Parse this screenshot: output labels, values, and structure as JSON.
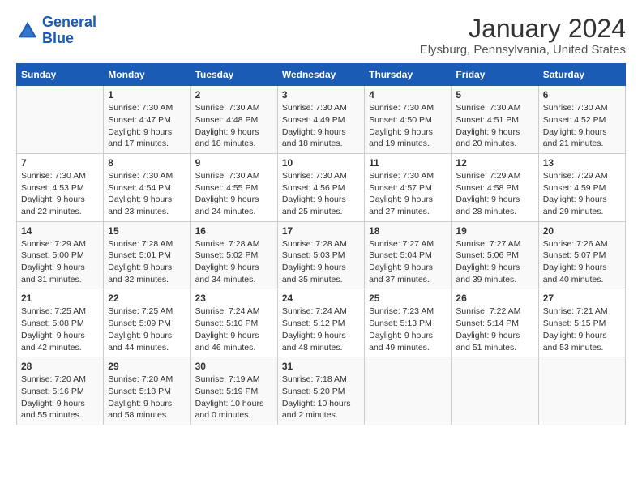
{
  "header": {
    "logo_line1": "General",
    "logo_line2": "Blue",
    "title": "January 2024",
    "subtitle": "Elysburg, Pennsylvania, United States"
  },
  "weekdays": [
    "Sunday",
    "Monday",
    "Tuesday",
    "Wednesday",
    "Thursday",
    "Friday",
    "Saturday"
  ],
  "weeks": [
    [
      {
        "day": "",
        "info": ""
      },
      {
        "day": "1",
        "info": "Sunrise: 7:30 AM\nSunset: 4:47 PM\nDaylight: 9 hours\nand 17 minutes."
      },
      {
        "day": "2",
        "info": "Sunrise: 7:30 AM\nSunset: 4:48 PM\nDaylight: 9 hours\nand 18 minutes."
      },
      {
        "day": "3",
        "info": "Sunrise: 7:30 AM\nSunset: 4:49 PM\nDaylight: 9 hours\nand 18 minutes."
      },
      {
        "day": "4",
        "info": "Sunrise: 7:30 AM\nSunset: 4:50 PM\nDaylight: 9 hours\nand 19 minutes."
      },
      {
        "day": "5",
        "info": "Sunrise: 7:30 AM\nSunset: 4:51 PM\nDaylight: 9 hours\nand 20 minutes."
      },
      {
        "day": "6",
        "info": "Sunrise: 7:30 AM\nSunset: 4:52 PM\nDaylight: 9 hours\nand 21 minutes."
      }
    ],
    [
      {
        "day": "7",
        "info": "Sunrise: 7:30 AM\nSunset: 4:53 PM\nDaylight: 9 hours\nand 22 minutes."
      },
      {
        "day": "8",
        "info": "Sunrise: 7:30 AM\nSunset: 4:54 PM\nDaylight: 9 hours\nand 23 minutes."
      },
      {
        "day": "9",
        "info": "Sunrise: 7:30 AM\nSunset: 4:55 PM\nDaylight: 9 hours\nand 24 minutes."
      },
      {
        "day": "10",
        "info": "Sunrise: 7:30 AM\nSunset: 4:56 PM\nDaylight: 9 hours\nand 25 minutes."
      },
      {
        "day": "11",
        "info": "Sunrise: 7:30 AM\nSunset: 4:57 PM\nDaylight: 9 hours\nand 27 minutes."
      },
      {
        "day": "12",
        "info": "Sunrise: 7:29 AM\nSunset: 4:58 PM\nDaylight: 9 hours\nand 28 minutes."
      },
      {
        "day": "13",
        "info": "Sunrise: 7:29 AM\nSunset: 4:59 PM\nDaylight: 9 hours\nand 29 minutes."
      }
    ],
    [
      {
        "day": "14",
        "info": "Sunrise: 7:29 AM\nSunset: 5:00 PM\nDaylight: 9 hours\nand 31 minutes."
      },
      {
        "day": "15",
        "info": "Sunrise: 7:28 AM\nSunset: 5:01 PM\nDaylight: 9 hours\nand 32 minutes."
      },
      {
        "day": "16",
        "info": "Sunrise: 7:28 AM\nSunset: 5:02 PM\nDaylight: 9 hours\nand 34 minutes."
      },
      {
        "day": "17",
        "info": "Sunrise: 7:28 AM\nSunset: 5:03 PM\nDaylight: 9 hours\nand 35 minutes."
      },
      {
        "day": "18",
        "info": "Sunrise: 7:27 AM\nSunset: 5:04 PM\nDaylight: 9 hours\nand 37 minutes."
      },
      {
        "day": "19",
        "info": "Sunrise: 7:27 AM\nSunset: 5:06 PM\nDaylight: 9 hours\nand 39 minutes."
      },
      {
        "day": "20",
        "info": "Sunrise: 7:26 AM\nSunset: 5:07 PM\nDaylight: 9 hours\nand 40 minutes."
      }
    ],
    [
      {
        "day": "21",
        "info": "Sunrise: 7:25 AM\nSunset: 5:08 PM\nDaylight: 9 hours\nand 42 minutes."
      },
      {
        "day": "22",
        "info": "Sunrise: 7:25 AM\nSunset: 5:09 PM\nDaylight: 9 hours\nand 44 minutes."
      },
      {
        "day": "23",
        "info": "Sunrise: 7:24 AM\nSunset: 5:10 PM\nDaylight: 9 hours\nand 46 minutes."
      },
      {
        "day": "24",
        "info": "Sunrise: 7:24 AM\nSunset: 5:12 PM\nDaylight: 9 hours\nand 48 minutes."
      },
      {
        "day": "25",
        "info": "Sunrise: 7:23 AM\nSunset: 5:13 PM\nDaylight: 9 hours\nand 49 minutes."
      },
      {
        "day": "26",
        "info": "Sunrise: 7:22 AM\nSunset: 5:14 PM\nDaylight: 9 hours\nand 51 minutes."
      },
      {
        "day": "27",
        "info": "Sunrise: 7:21 AM\nSunset: 5:15 PM\nDaylight: 9 hours\nand 53 minutes."
      }
    ],
    [
      {
        "day": "28",
        "info": "Sunrise: 7:20 AM\nSunset: 5:16 PM\nDaylight: 9 hours\nand 55 minutes."
      },
      {
        "day": "29",
        "info": "Sunrise: 7:20 AM\nSunset: 5:18 PM\nDaylight: 9 hours\nand 58 minutes."
      },
      {
        "day": "30",
        "info": "Sunrise: 7:19 AM\nSunset: 5:19 PM\nDaylight: 10 hours\nand 0 minutes."
      },
      {
        "day": "31",
        "info": "Sunrise: 7:18 AM\nSunset: 5:20 PM\nDaylight: 10 hours\nand 2 minutes."
      },
      {
        "day": "",
        "info": ""
      },
      {
        "day": "",
        "info": ""
      },
      {
        "day": "",
        "info": ""
      }
    ]
  ]
}
